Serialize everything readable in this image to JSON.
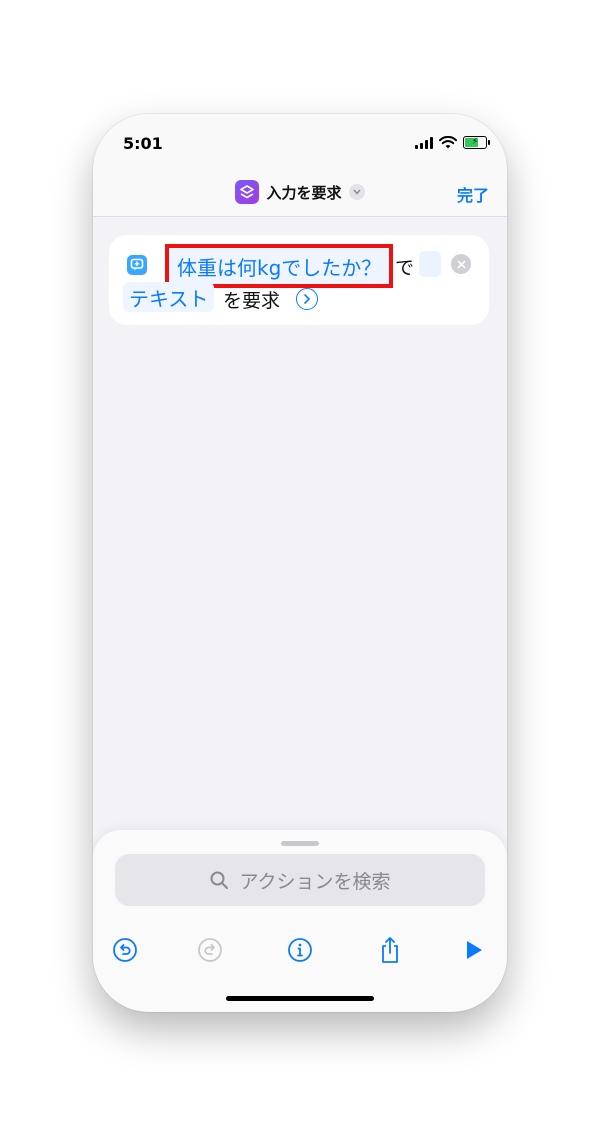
{
  "status": {
    "time": "5:01"
  },
  "header": {
    "title": "入力を要求",
    "done_label": "完了"
  },
  "action": {
    "prompt_token": "体重は何kgでしたか？",
    "connector": "で",
    "type_token": "テキスト",
    "suffix": "を要求"
  },
  "bottom": {
    "search_placeholder": "アクションを検索"
  },
  "colors": {
    "accent": "#0a7aff",
    "highlight_border": "#ee1111",
    "shortcut_icon": "#7a5af8"
  },
  "icons": {
    "toolbar": [
      "undo-icon",
      "redo-icon",
      "info-icon",
      "share-icon",
      "play-icon"
    ],
    "status": [
      "signal-icon",
      "wifi-icon",
      "battery-icon"
    ]
  }
}
